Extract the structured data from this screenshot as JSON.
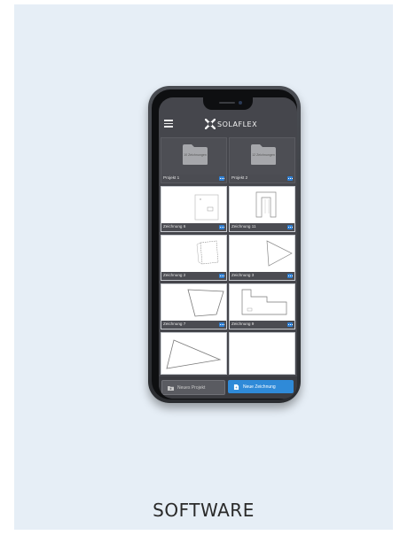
{
  "caption": "SOFTWARE",
  "app": {
    "logo_text": "SOLAFLEX"
  },
  "projects": [
    {
      "label": "Projekt 1",
      "count": "10 Zeichnungen"
    },
    {
      "label": "Projekt 2",
      "count": "12 Zeichnungen"
    }
  ],
  "drawings": [
    {
      "label": "Zeichnung 6"
    },
    {
      "label": "Zeichnung 11"
    },
    {
      "label": "Zeichnung 2"
    },
    {
      "label": "Zeichnung 3"
    },
    {
      "label": "Zeichnung 7"
    },
    {
      "label": "Zeichnung 9"
    }
  ],
  "buttons": {
    "new_project": "Neues Projekt",
    "new_drawing": "Neue Zeichnung"
  },
  "colors": {
    "accent": "#2f8ad8",
    "background": "#e6eef6"
  }
}
